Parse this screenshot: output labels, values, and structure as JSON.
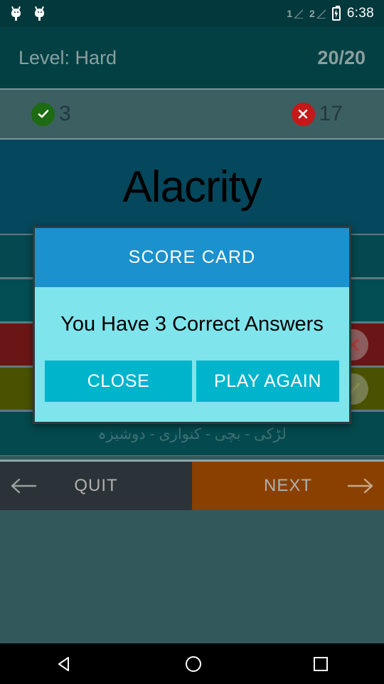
{
  "status_bar": {
    "notification_icons": [
      "android-robot-icon",
      "android-robot-icon"
    ],
    "sim1_label": "1",
    "sim2_label": "2",
    "battery_icon": "battery-charging-icon",
    "time": "6:38"
  },
  "quiz_header": {
    "level": "Level: Hard",
    "progress": "20/20"
  },
  "score_strip": {
    "correct_icon": "check-circle-icon",
    "correct_count": "3",
    "wrong_icon": "cross-circle-icon",
    "wrong_count": "17"
  },
  "question": {
    "word": "Alacrity"
  },
  "options": [
    {
      "color": "#05484f",
      "icon": ""
    },
    {
      "color": "#034e55",
      "icon": ""
    },
    {
      "color": "#6b1616",
      "icon": "cross-icon"
    },
    {
      "color": "#4a5202",
      "icon": "check-icon"
    },
    {
      "color": "#05484f",
      "icon": ""
    }
  ],
  "hint": {
    "text": "لڑکی - بچی - کنواری - دوشیزہ"
  },
  "action_bar": {
    "quit_label": "QUIT",
    "quit_icon": "arrow-left-icon",
    "next_label": "NEXT",
    "next_icon": "arrow-right-icon"
  },
  "dialog": {
    "title": "SCORE CARD",
    "message": "You Have 3 Correct Answers",
    "close_label": "CLOSE",
    "play_again_label": "PLAY AGAIN"
  },
  "nav_bar": {
    "back_icon": "nav-back-icon",
    "home_icon": "nav-home-icon",
    "recents_icon": "nav-recents-icon"
  },
  "colors": {
    "header_bg": "#034044",
    "question_bg": "#05475c",
    "dialog_header": "#1b91cd",
    "dialog_body": "#7fe4ec",
    "dialog_button": "#00b4cc",
    "next_bg": "#8a4000",
    "correct_badge": "#1d6b12",
    "wrong_badge": "#c41919"
  }
}
